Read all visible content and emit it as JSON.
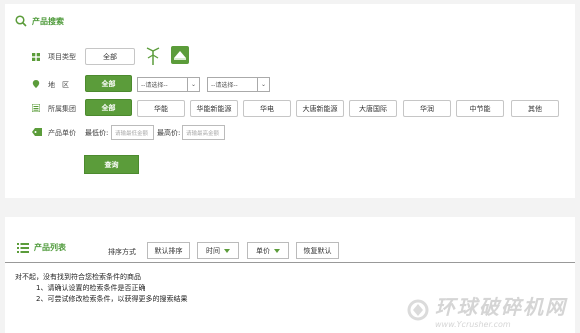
{
  "search": {
    "title": "产品搜索",
    "rows": {
      "project_type": {
        "label": "项目类型",
        "all": "全部"
      },
      "region": {
        "label": "地　区",
        "all": "全部",
        "province": "--请选择--",
        "city": "--请选择--"
      },
      "group": {
        "label": "所属集团",
        "all": "全部",
        "options": [
          "华能",
          "华能新能源",
          "华电",
          "大唐新能源",
          "大唐国际",
          "华润",
          "中节能",
          "其他"
        ]
      },
      "price": {
        "label": "产品单价",
        "min_label": "最低价:",
        "min_placeholder": "请输最低金额",
        "max_label": "最高价:",
        "max_placeholder": "请输最高金额"
      }
    },
    "query_button": "查询"
  },
  "list": {
    "title": "产品列表",
    "sort_label": "排序方式",
    "sort_buttons": [
      "默认排序",
      "时间",
      "单价",
      "恢复默认"
    ],
    "messages": [
      "对不起，没有找到符合您检索条件的商品",
      "1、请确认设置的检索条件是否正确",
      "2、可尝试修改检索条件，以获得更多的搜索结果"
    ]
  },
  "watermark": {
    "main": "环球破碎机网",
    "url": "www.Ycrusher.com"
  },
  "colors": {
    "accent": "#5b9c3a",
    "title_green": "#4e9a3a"
  }
}
